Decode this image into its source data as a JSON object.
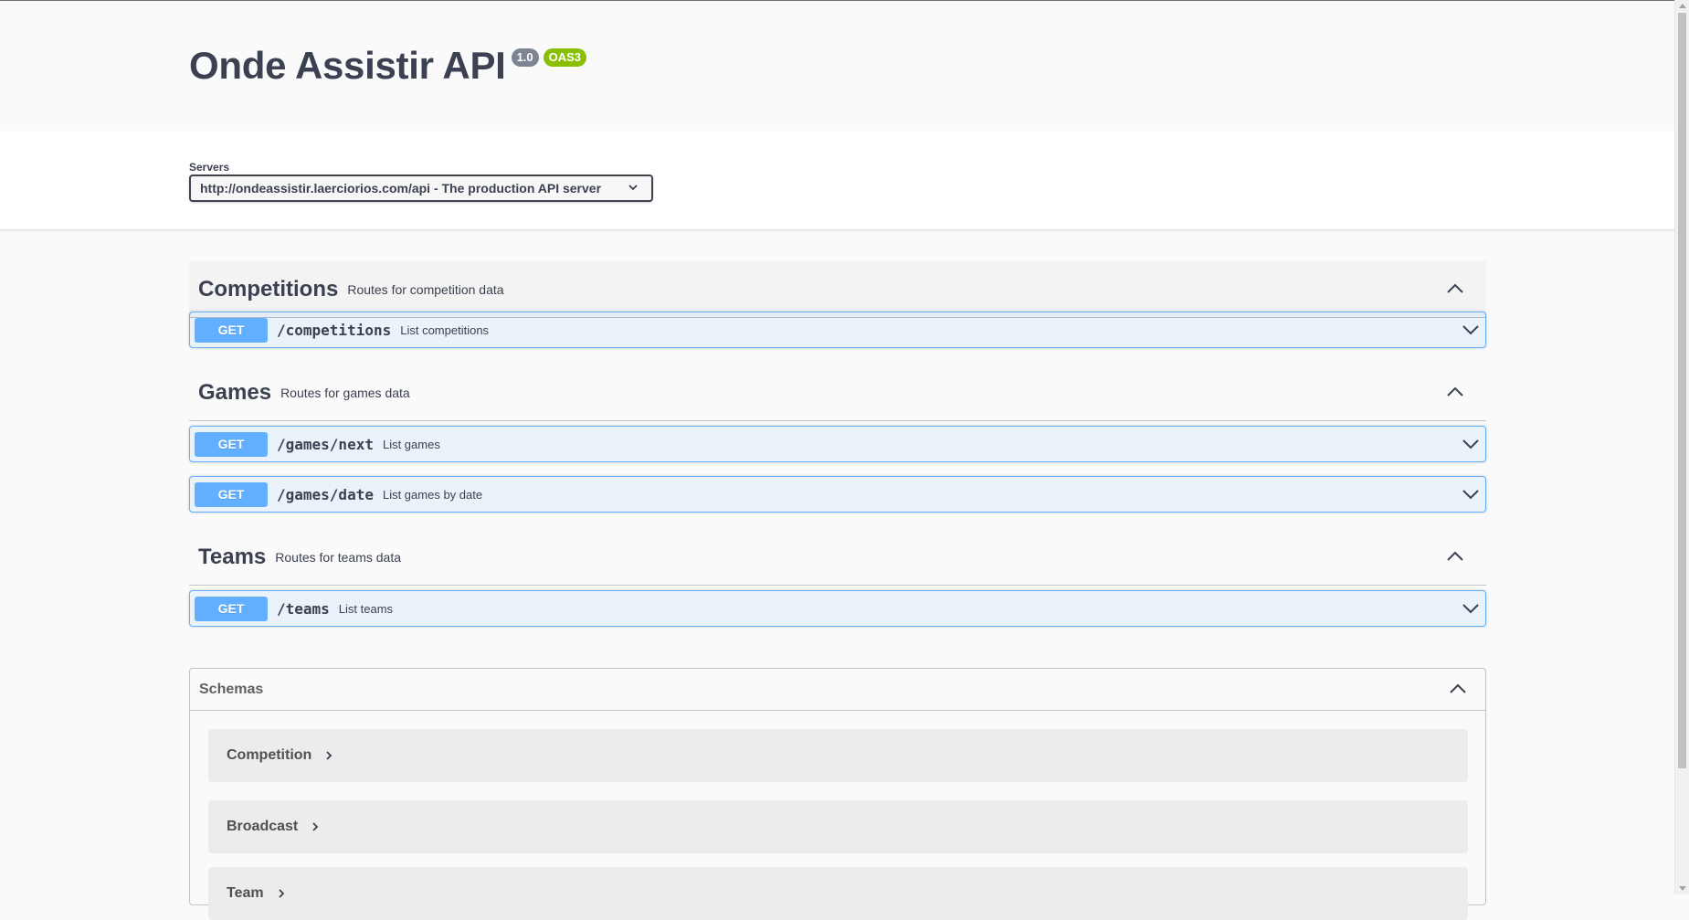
{
  "info": {
    "title": "Onde Assistir API",
    "version": "1.0",
    "oas": "OAS3"
  },
  "servers": {
    "label": "Servers",
    "selected": "http://ondeassistir.laerciorios.com/api - The production API server"
  },
  "tags": [
    {
      "name": "Competitions",
      "description": "Routes for competition data",
      "operations": [
        {
          "method": "GET",
          "path": "/competitions",
          "summary": "List competitions"
        }
      ]
    },
    {
      "name": "Games",
      "description": "Routes for games data",
      "operations": [
        {
          "method": "GET",
          "path": "/games/next",
          "summary": "List games"
        },
        {
          "method": "GET",
          "path": "/games/date",
          "summary": "List games by date"
        }
      ]
    },
    {
      "name": "Teams",
      "description": "Routes for teams data",
      "operations": [
        {
          "method": "GET",
          "path": "/teams",
          "summary": "List teams"
        }
      ]
    }
  ],
  "schemas": {
    "title": "Schemas",
    "models": [
      "Competition",
      "Broadcast",
      "Team"
    ]
  },
  "colors": {
    "get_method": "#61affe",
    "oas_badge": "#89bf04",
    "version_badge": "#7d8492"
  }
}
